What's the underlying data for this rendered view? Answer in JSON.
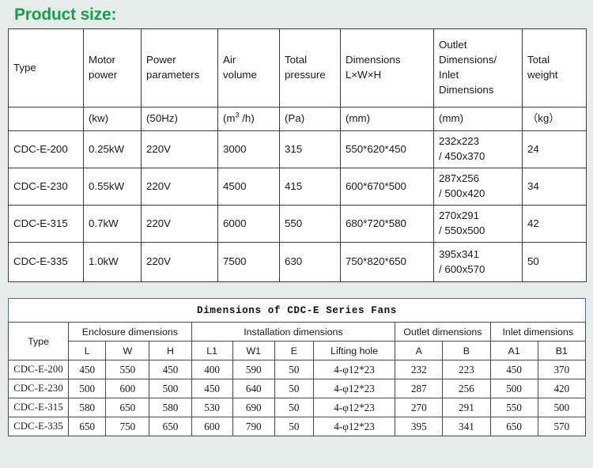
{
  "page": {
    "title": "Product size:",
    "title_color": "#17a04a",
    "background_color": "#e5ece9"
  },
  "table1": {
    "header": [
      {
        "label": "Type",
        "unit": ""
      },
      {
        "label": "Motor power",
        "line1": "Motor",
        "line2": "power",
        "unit": "(kw)"
      },
      {
        "label": "Power parameters",
        "line1": "Power",
        "line2": "parameters",
        "unit": "(50Hz)"
      },
      {
        "label": "Air volume",
        "line1": "Air",
        "line2": "volume",
        "unit": "(m³ /h)",
        "unit_base": "(m",
        "unit_sup": "3",
        "unit_tail": " /h)"
      },
      {
        "label": "Total pressure",
        "line1": "Total",
        "line2": "pressure",
        "unit": "(Pa)"
      },
      {
        "label": "Dimensions L×W×H",
        "line1": "Dimensions",
        "line2": "L×W×H",
        "unit": "(mm)"
      },
      {
        "label": "Outlet Dimensions/ Inlet Dimensions",
        "line1": "Outlet",
        "line2": "Dimensions/",
        "line3": "Inlet",
        "line4": "Dimensions",
        "unit": "(mm)"
      },
      {
        "label": "Total weight",
        "line1": "Total",
        "line2": "weight",
        "unit": "（kg）"
      }
    ],
    "rows": [
      {
        "type": "CDC-E-200",
        "motor_power": "0.25kW",
        "power_parameters": "220V",
        "air_volume": "3000",
        "total_pressure": "315",
        "dimensions": "550*620*450",
        "outlet_inlet_1": "232x223",
        "outlet_inlet_2": "/ 450x370",
        "total_weight": "24"
      },
      {
        "type": "CDC-E-230",
        "motor_power": "0.55kW",
        "power_parameters": "220V",
        "air_volume": "4500",
        "total_pressure": "415",
        "dimensions": "600*670*500",
        "outlet_inlet_1": "287x256",
        "outlet_inlet_2": "/ 500x420",
        "total_weight": "34"
      },
      {
        "type": "CDC-E-315",
        "motor_power": "0.7kW",
        "power_parameters": "220V",
        "air_volume": "6000",
        "total_pressure": "550",
        "dimensions": "680*720*580",
        "outlet_inlet_1": "270x291",
        "outlet_inlet_2": "/ 550x500",
        "total_weight": "42"
      },
      {
        "type": "CDC-E-335",
        "motor_power": "1.0kW",
        "power_parameters": "220V",
        "air_volume": "7500",
        "total_pressure": "630",
        "dimensions": "750*820*650",
        "outlet_inlet_1": "395x341",
        "outlet_inlet_2": "/ 600x570",
        "total_weight": "50"
      }
    ]
  },
  "table2": {
    "title": "Dimensions of CDC-E Series Fans",
    "group_headers": [
      {
        "label": "Type",
        "span": 1
      },
      {
        "label": "Enclosure dimensions",
        "span": 3
      },
      {
        "label": "Installation dimensions",
        "span": 4
      },
      {
        "label": "Outlet dimensions",
        "span": 2
      },
      {
        "label": "Inlet dimensions",
        "span": 2
      }
    ],
    "sub_headers": [
      "L",
      "W",
      "H",
      "L1",
      "W1",
      "E",
      "Lifting hole",
      "A",
      "B",
      "A1",
      "B1"
    ],
    "rows": [
      {
        "type": "CDC-E-200",
        "L": "450",
        "W": "550",
        "H": "450",
        "L1": "400",
        "W1": "590",
        "E": "50",
        "lifting_hole": "4-φ12*23",
        "A": "232",
        "B": "223",
        "A1": "450",
        "B1": "370"
      },
      {
        "type": "CDC-E-230",
        "L": "500",
        "W": "600",
        "H": "500",
        "L1": "450",
        "W1": "640",
        "E": "50",
        "lifting_hole": "4-φ12*23",
        "A": "287",
        "B": "256",
        "A1": "500",
        "B1": "420"
      },
      {
        "type": "CDC-E-315",
        "L": "580",
        "W": "650",
        "H": "580",
        "L1": "530",
        "W1": "690",
        "E": "50",
        "lifting_hole": "4-φ12*23",
        "A": "270",
        "B": "291",
        "A1": "550",
        "B1": "500"
      },
      {
        "type": "CDC-E-335",
        "L": "650",
        "W": "750",
        "H": "650",
        "L1": "600",
        "W1": "790",
        "E": "50",
        "lifting_hole": "4-φ12*23",
        "A": "395",
        "B": "341",
        "A1": "650",
        "B1": "570"
      }
    ]
  }
}
